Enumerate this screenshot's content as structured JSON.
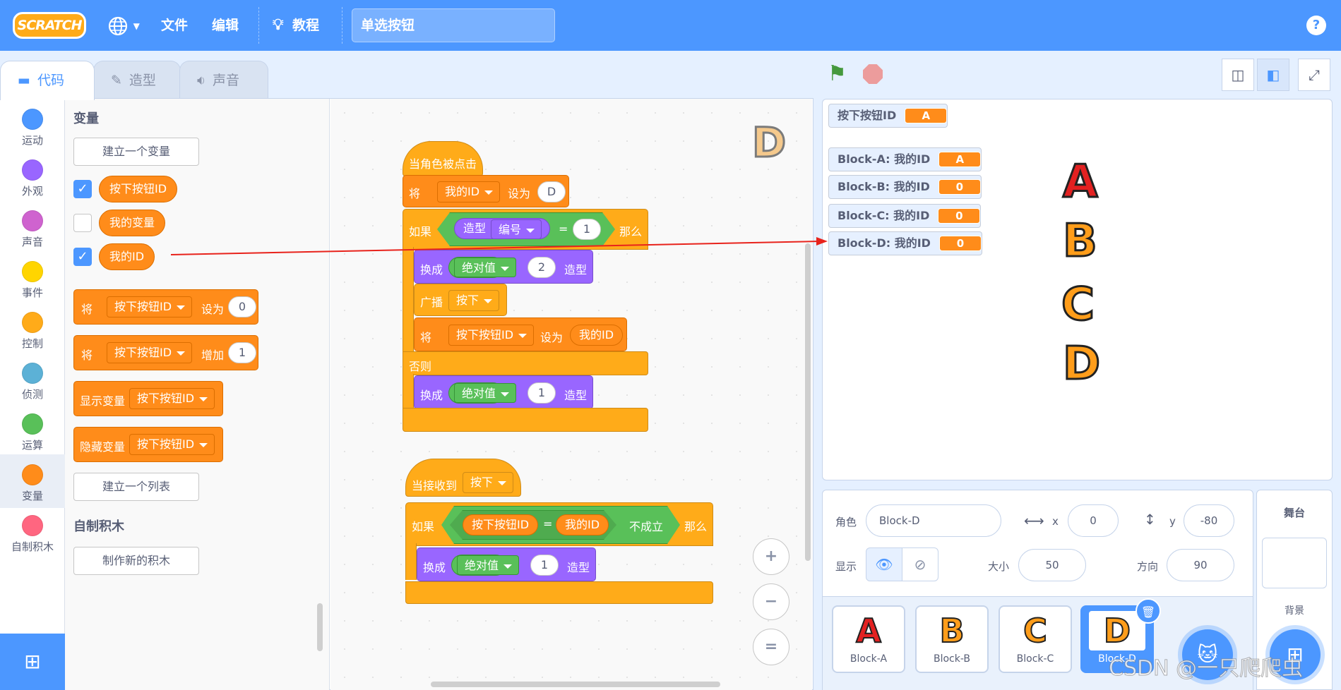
{
  "menubar": {
    "logo": "SCRATCH",
    "file": "文件",
    "edit": "编辑",
    "tutorials": "教程",
    "project_title": "单选按钮",
    "help": "?"
  },
  "tabs": [
    {
      "label": "代码",
      "icon": "code-icon"
    },
    {
      "label": "造型",
      "icon": "brush-icon"
    },
    {
      "label": "声音",
      "icon": "speaker-icon"
    }
  ],
  "categories": [
    {
      "label": "运动",
      "color": "#4c97ff"
    },
    {
      "label": "外观",
      "color": "#9966ff"
    },
    {
      "label": "声音",
      "color": "#cf63cf"
    },
    {
      "label": "事件",
      "color": "#ffd500"
    },
    {
      "label": "控制",
      "color": "#ffab19"
    },
    {
      "label": "侦测",
      "color": "#5cb1d6"
    },
    {
      "label": "运算",
      "color": "#59c059"
    },
    {
      "label": "变量",
      "color": "#ff8c1a"
    },
    {
      "label": "自制积木",
      "color": "#ff6680"
    }
  ],
  "flyout": {
    "variables_title": "变量",
    "make_variable": "建立一个变量",
    "vars": [
      "按下按钮ID",
      "我的变量",
      "我的ID"
    ],
    "set_label": "将",
    "set_to": "设为",
    "set_var": "按下按钮ID",
    "set_value": "0",
    "change_label": "将",
    "change_by": "增加",
    "change_var": "按下按钮ID",
    "change_value": "1",
    "show_var_label": "显示变量",
    "show_var": "按下按钮ID",
    "hide_var_label": "隐藏变量",
    "hide_var": "按下按钮ID",
    "make_list": "建立一个列表",
    "my_blocks_title": "自制积木",
    "make_block": "制作新的积木"
  },
  "script1": {
    "hat": "当角色被点击",
    "set_label": "将",
    "set_var": "我的ID",
    "set_to": "设为",
    "set_value": "D",
    "if_label": "如果",
    "costume": "造型",
    "costume_prop": "编号",
    "eq": "=",
    "eq_value": "1",
    "then": "那么",
    "switch1_label": "换成",
    "abs1": "绝对值",
    "abs1_value": "2",
    "costume1": "造型",
    "broadcast_label": "广播",
    "broadcast_msg": "按下",
    "set2_label": "将",
    "set2_var": "按下按钮ID",
    "set2_to": "设为",
    "set2_value": "我的ID",
    "else": "否则",
    "switch2_label": "换成",
    "abs2": "绝对值",
    "abs2_value": "1",
    "costume2": "造型"
  },
  "script2": {
    "hat": "当接收到",
    "hat_msg": "按下",
    "if_label": "如果",
    "left": "按下按钮ID",
    "eq": "=",
    "right": "我的ID",
    "not_true": "不成立",
    "then": "那么",
    "switch_label": "换成",
    "abs": "绝对值",
    "abs_value": "1",
    "costume": "造型"
  },
  "workspace": {
    "sprite_thumb": "D",
    "zoom_in": "+",
    "zoom_out": "−",
    "reset": "="
  },
  "stage": {
    "monitors": [
      {
        "label": "按下按钮ID",
        "value": "A"
      },
      {
        "label": "Block-A: 我的ID",
        "value": "A"
      },
      {
        "label": "Block-B: 我的ID",
        "value": "0"
      },
      {
        "label": "Block-C: 我的ID",
        "value": "0"
      },
      {
        "label": "Block-D: 我的ID",
        "value": "0"
      }
    ],
    "letters": [
      {
        "char": "A",
        "color": "#e32121"
      },
      {
        "char": "B",
        "color": "#ff9d1a"
      },
      {
        "char": "C",
        "color": "#ff9d1a"
      },
      {
        "char": "D",
        "color": "#ff9d1a"
      }
    ]
  },
  "sprite_info": {
    "sprite_label": "角色",
    "sprite_name": "Block-D",
    "x_label": "x",
    "x": "0",
    "y_label": "y",
    "y": "-80",
    "show_label": "显示",
    "size_label": "大小",
    "size": "50",
    "direction_label": "方向",
    "direction": "90"
  },
  "sprites": [
    {
      "name": "Block-A",
      "char": "A",
      "color": "#e32121"
    },
    {
      "name": "Block-B",
      "char": "B",
      "color": "#ff9d1a"
    },
    {
      "name": "Block-C",
      "char": "C",
      "color": "#ff9d1a"
    },
    {
      "name": "Block-D",
      "char": "D",
      "color": "#ff9d1a"
    }
  ],
  "stage_pane": {
    "title": "舞台",
    "backdrop_label": "背景"
  },
  "watermark": "CSDN @一只爬爬虫"
}
